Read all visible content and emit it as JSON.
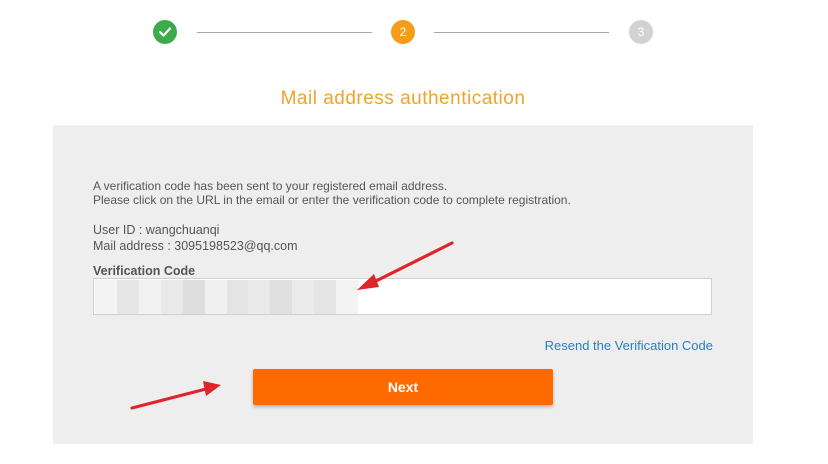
{
  "stepper": {
    "steps": [
      {
        "label": "✓",
        "state": "completed",
        "color": "#3cab4a"
      },
      {
        "label": "2",
        "state": "active",
        "color": "#f59c1a"
      },
      {
        "label": "3",
        "state": "pending",
        "color": "#d2d2d2"
      }
    ]
  },
  "page_title": "Mail address authentication",
  "panel": {
    "message_line_1": "A verification code has been sent to your registered email address.",
    "message_line_2": "Please click on the URL in the email or enter the verification code to complete registration.",
    "user_id": "User ID : wangchuanqi",
    "mail_address": "Mail address : 3095198523@qq.com",
    "code_label": "Verification Code",
    "code_placeholder": "",
    "resend_link": "Resend the Verification Code",
    "next_button": "Next"
  },
  "colors": {
    "accent_orange": "#ff6a00",
    "title_orange": "#f0a32a",
    "link_blue": "#2a7fbf",
    "annotation_red": "#e0242b"
  },
  "icons": {
    "step_1": "checkmark-icon",
    "annotations": "red-arrow-icon"
  }
}
